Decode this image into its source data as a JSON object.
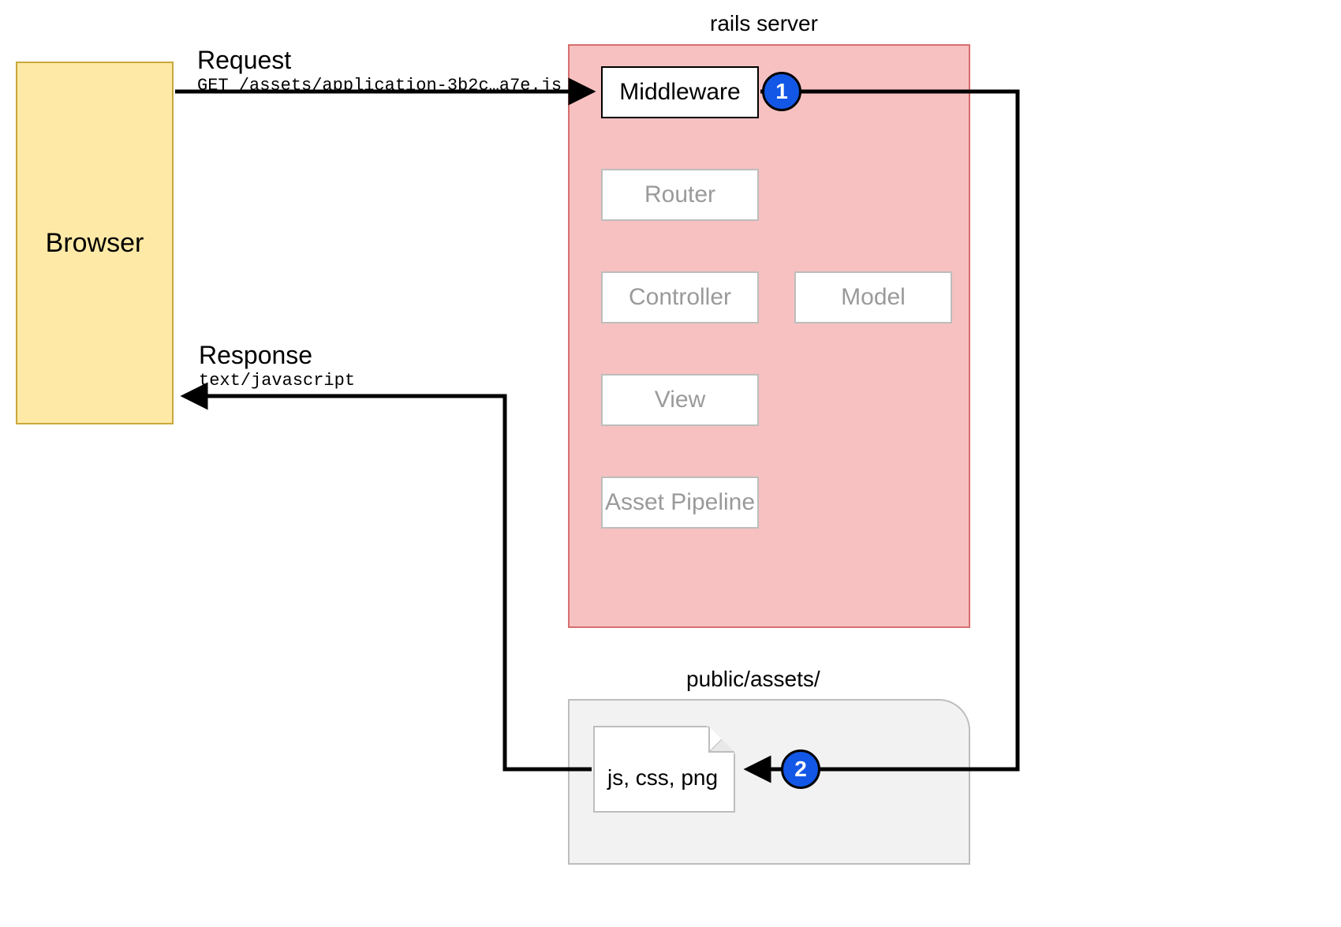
{
  "browser": {
    "label": "Browser"
  },
  "request": {
    "title": "Request",
    "detail": "GET /assets/application-3b2c…a7e.js"
  },
  "response": {
    "title": "Response",
    "detail": "text/javascript"
  },
  "rails": {
    "title": "rails server",
    "nodes": {
      "middleware": "Middleware",
      "router": "Router",
      "controller": "Controller",
      "model": "Model",
      "view": "View",
      "pipeline": "Asset Pipeline"
    }
  },
  "assets": {
    "title": "public/assets/",
    "file_label": "js, css, png"
  },
  "badges": {
    "one": "1",
    "two": "2"
  }
}
